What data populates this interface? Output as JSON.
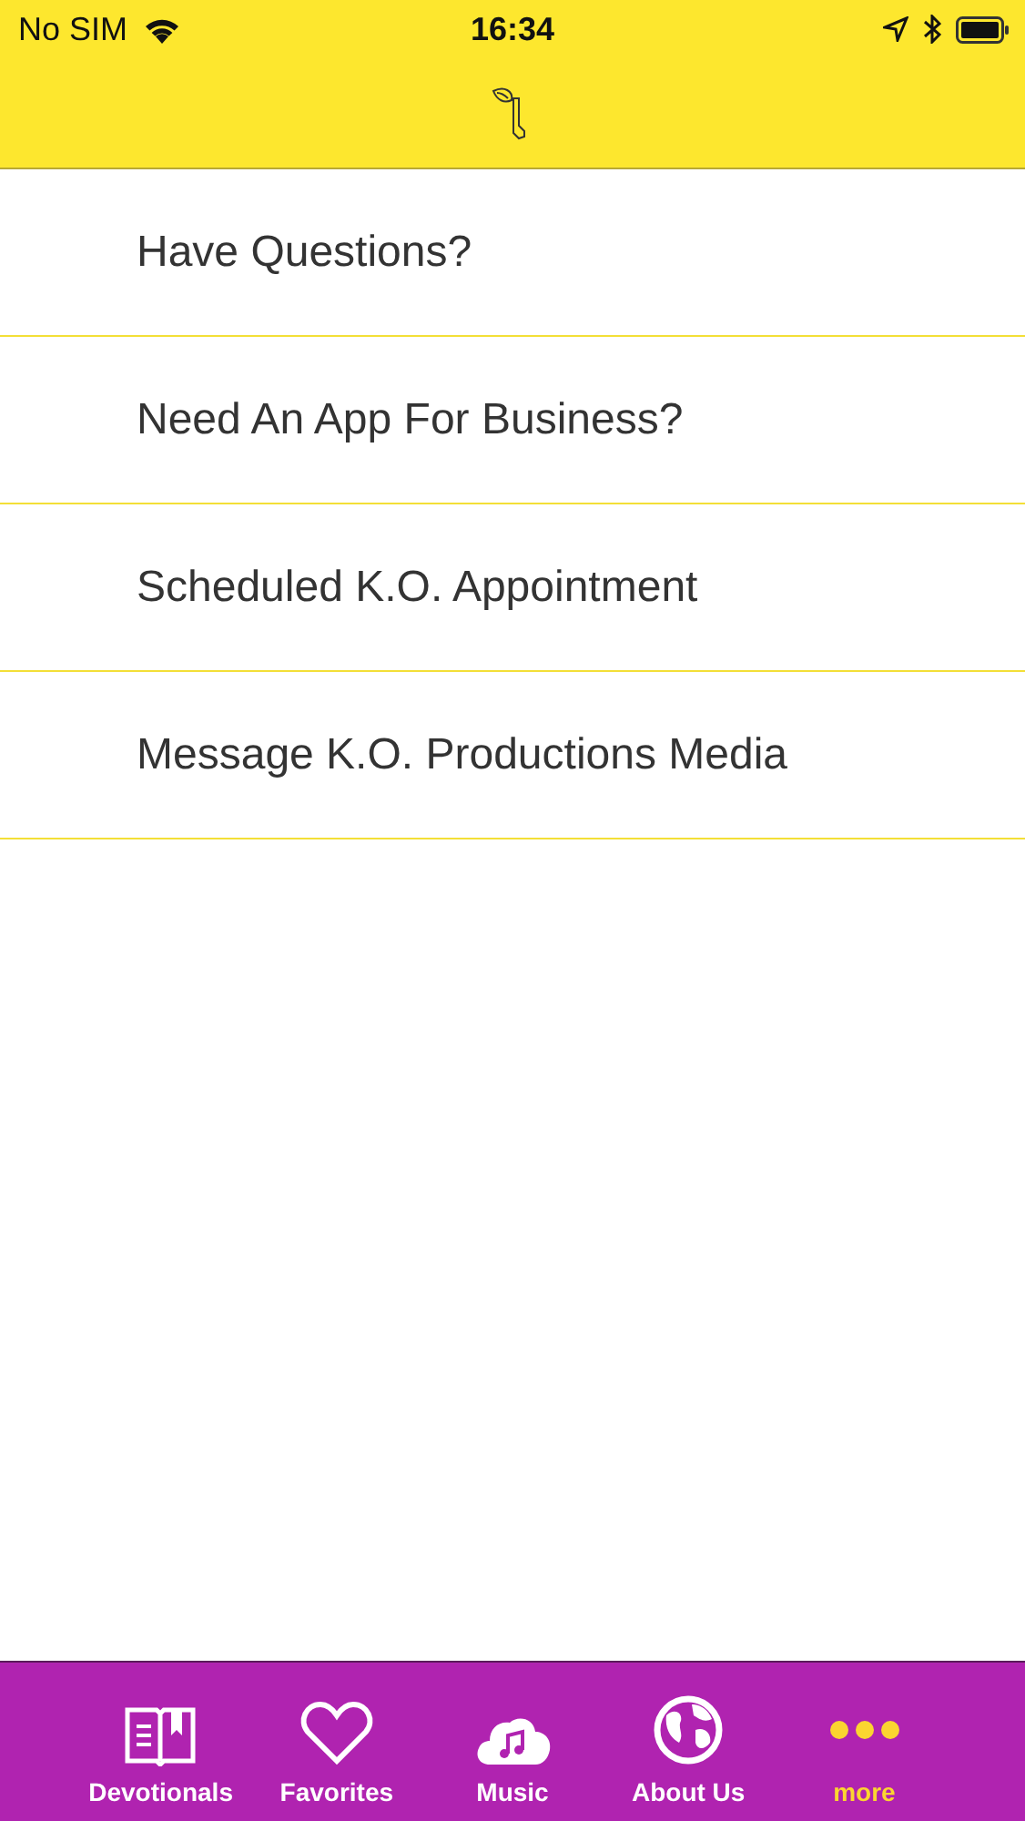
{
  "status_bar": {
    "carrier": "No SIM",
    "time": "16:34"
  },
  "menu_items": [
    {
      "label": "Have Questions?"
    },
    {
      "label": "Need An App For Business?"
    },
    {
      "label": "Scheduled K.O. Appointment"
    },
    {
      "label": "Message K.O. Productions Media"
    }
  ],
  "tab_bar": [
    {
      "label": "Devotionals",
      "kind": "book",
      "selected": false
    },
    {
      "label": "Favorites",
      "kind": "heart",
      "selected": false
    },
    {
      "label": "Music",
      "kind": "cloud",
      "selected": false
    },
    {
      "label": "About Us",
      "kind": "globe",
      "selected": false
    },
    {
      "label": "more",
      "kind": "dots",
      "selected": true
    }
  ]
}
